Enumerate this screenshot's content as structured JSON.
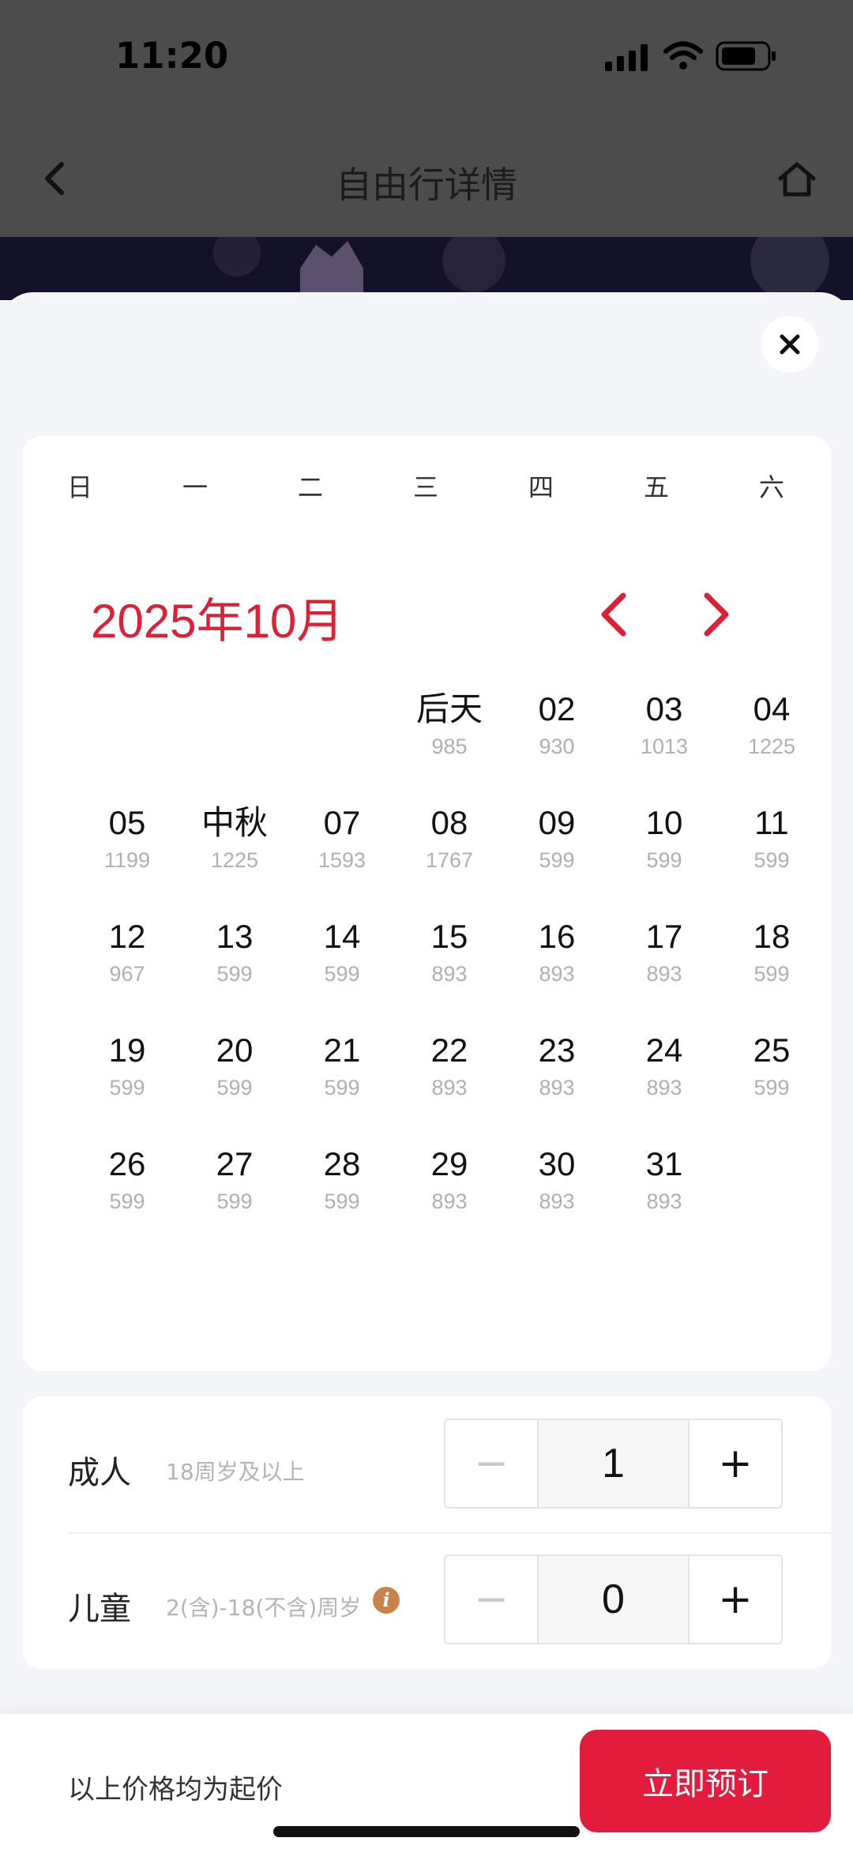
{
  "status_bar": {
    "time": "11:20"
  },
  "nav": {
    "title": "自由行详情"
  },
  "calendar": {
    "weekdays": [
      "日",
      "一",
      "二",
      "三",
      "四",
      "五",
      "六"
    ],
    "month_label": "2025年10月",
    "weeks": [
      [
        null,
        null,
        null,
        {
          "day": "后天",
          "price": "985"
        },
        {
          "day": "02",
          "price": "930"
        },
        {
          "day": "03",
          "price": "1013"
        },
        {
          "day": "04",
          "price": "1225"
        }
      ],
      [
        {
          "day": "05",
          "price": "1199"
        },
        {
          "day": "中秋",
          "price": "1225"
        },
        {
          "day": "07",
          "price": "1593"
        },
        {
          "day": "08",
          "price": "1767"
        },
        {
          "day": "09",
          "price": "599"
        },
        {
          "day": "10",
          "price": "599"
        },
        {
          "day": "11",
          "price": "599"
        }
      ],
      [
        {
          "day": "12",
          "price": "967"
        },
        {
          "day": "13",
          "price": "599"
        },
        {
          "day": "14",
          "price": "599"
        },
        {
          "day": "15",
          "price": "893"
        },
        {
          "day": "16",
          "price": "893"
        },
        {
          "day": "17",
          "price": "893"
        },
        {
          "day": "18",
          "price": "599"
        }
      ],
      [
        {
          "day": "19",
          "price": "599"
        },
        {
          "day": "20",
          "price": "599"
        },
        {
          "day": "21",
          "price": "599"
        },
        {
          "day": "22",
          "price": "893"
        },
        {
          "day": "23",
          "price": "893"
        },
        {
          "day": "24",
          "price": "893"
        },
        {
          "day": "25",
          "price": "599"
        }
      ],
      [
        {
          "day": "26",
          "price": "599"
        },
        {
          "day": "27",
          "price": "599"
        },
        {
          "day": "28",
          "price": "599"
        },
        {
          "day": "29",
          "price": "893"
        },
        {
          "day": "30",
          "price": "893"
        },
        {
          "day": "31",
          "price": "893"
        },
        null
      ]
    ]
  },
  "travelers": {
    "adult": {
      "label": "成人",
      "desc": "18周岁及以上",
      "minus": "−",
      "value": "1",
      "plus": "+"
    },
    "child": {
      "label": "儿童",
      "desc": "2(含)-18(不含)周岁",
      "minus": "−",
      "value": "0",
      "plus": "+"
    }
  },
  "footer": {
    "note": "以上价格均为起价",
    "book_label": "立即预订"
  },
  "colors": {
    "accent": "#e31b3c",
    "month_red": "#dd2035",
    "info_badge": "#c9834a"
  },
  "icons": [
    "back-icon",
    "home-icon",
    "signal-icon",
    "wifi-icon",
    "battery-icon",
    "close-icon",
    "prev-month-icon",
    "next-month-icon",
    "info-icon"
  ]
}
